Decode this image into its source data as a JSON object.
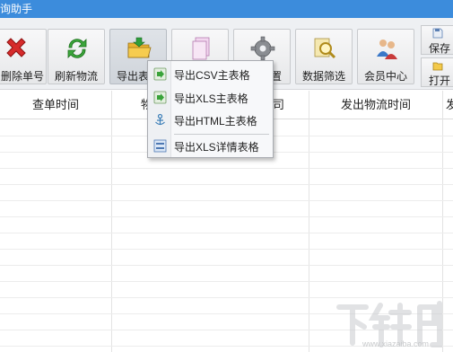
{
  "window": {
    "title": "询助手"
  },
  "toolbar": {
    "buttons": [
      {
        "label": "删除单号",
        "icon": "delete-x-icon"
      },
      {
        "label": "刷新物流",
        "icon": "refresh-icon"
      },
      {
        "label": "导出表",
        "icon": "export-folder-icon",
        "active": true
      },
      {
        "label": "",
        "icon": "document-icon"
      },
      {
        "label": "置",
        "icon": "gear-icon"
      },
      {
        "label": "数据筛选",
        "icon": "search-filter-icon"
      },
      {
        "label": "会员中心",
        "icon": "members-icon"
      }
    ],
    "side": [
      {
        "label": "保存",
        "icon": "save-icon"
      },
      {
        "label": "打开",
        "icon": "open-icon"
      }
    ]
  },
  "grid": {
    "columns": [
      "查单时间",
      "物",
      "司",
      "发出物流时间",
      "发"
    ]
  },
  "export_menu": {
    "items": [
      {
        "label": "导出CSV主表格",
        "icon": "export-csv-icon"
      },
      {
        "label": "导出XLS主表格",
        "icon": "export-xls-icon"
      },
      {
        "label": "导出HTML主表格",
        "icon": "export-html-icon"
      },
      {
        "label": "导出XLS详情表格",
        "icon": "export-xls-detail-icon"
      }
    ]
  },
  "watermark": {
    "text": "下载吧",
    "url": "www.xiazaiba.com"
  },
  "colors": {
    "titlebar": "#3c8cdc",
    "toolbar": "#eef0f3",
    "menu": "#f7f8fa"
  }
}
